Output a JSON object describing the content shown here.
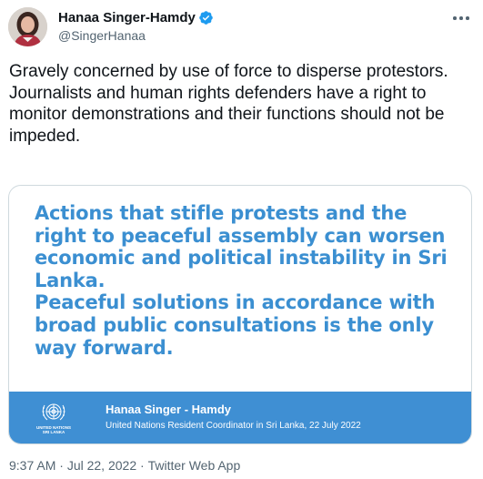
{
  "author": {
    "name": "Hanaa Singer-Hamdy",
    "handle": "@SingerHanaa",
    "verified": true
  },
  "tweet": {
    "text": "Gravely concerned by use of force to disperse protestors.\nJournalists and human rights defenders have a right to monitor demonstrations and their functions should not be impeded."
  },
  "card": {
    "statement": "Actions that stifle protests and the right to peaceful assembly can worsen economic and political instability in Sri Lanka.\nPeaceful solutions in accordance with broad public consultations is the only way forward.",
    "logo_label": "UNITED NATIONS\nSRI LANKA",
    "signatory_name": "Hanaa Singer - Hamdy",
    "signatory_title": "United Nations Resident Coordinator in Sri Lanka, 22 July 2022"
  },
  "meta": {
    "time": "9:37 AM",
    "separator": " · ",
    "date": "Jul 22, 2022",
    "source": "Twitter Web App"
  },
  "colors": {
    "accent_text": "#3b8fd1",
    "banner": "#3f8fd3",
    "verified": "#1d9bf0",
    "muted": "#536471"
  },
  "icons": [
    "more-options-icon",
    "verified-badge-icon",
    "un-emblem-icon"
  ]
}
